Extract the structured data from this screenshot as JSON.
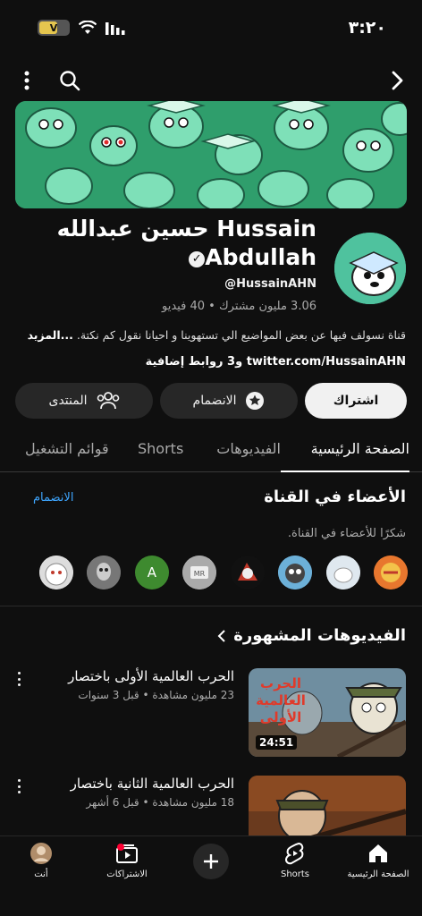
{
  "status_bar": {
    "time": "٣:٢٠",
    "battery_label": "V"
  },
  "channel": {
    "name_line1": "حسين عبدالله Hussain",
    "name_line2": "Abdullah",
    "handle": "@HussainAHN",
    "subscribers": "3.06 مليون مشترك",
    "videos": "40 فيديو",
    "separator": "•",
    "description": "قناة نسولف فيها عن بعض المواضيع الي تستهوينا و احيانا نقول كم نكتة.",
    "more_label": "...المزيد",
    "link_text": "twitter.com/HussainAHN",
    "extra_links": "و3 روابط إضافية"
  },
  "buttons": {
    "subscribe": "اشتراك",
    "join": "الانضمام",
    "community": "المنتدى"
  },
  "tabs": [
    "الصفحة الرئيسية",
    "الفيديوهات",
    "Shorts",
    "قوائم التشغيل"
  ],
  "members": {
    "title": "الأعضاء في القناة",
    "join_link": "الانضمام",
    "subtitle": "شكرًا للأعضاء في القناة.",
    "avatar_letter": "A"
  },
  "popular": {
    "title": "الفيديوهات المشهورة",
    "videos": [
      {
        "title": "الحرب العالمية الأولى باختصار",
        "meta": "23 مليون مشاهدة • قبل 3 سنوات",
        "duration": "24:51",
        "thumb_text": "الحرب العالمية الأولى"
      },
      {
        "title": "الحرب العالمية الثانية باختصار",
        "meta": "18 مليون مشاهدة • قبل 6 أشهر",
        "duration": ""
      }
    ]
  },
  "bottom_nav": {
    "home": "الصفحة الرئيسية",
    "shorts": "Shorts",
    "subscriptions": "الاشتراكات",
    "you": "أنت"
  }
}
